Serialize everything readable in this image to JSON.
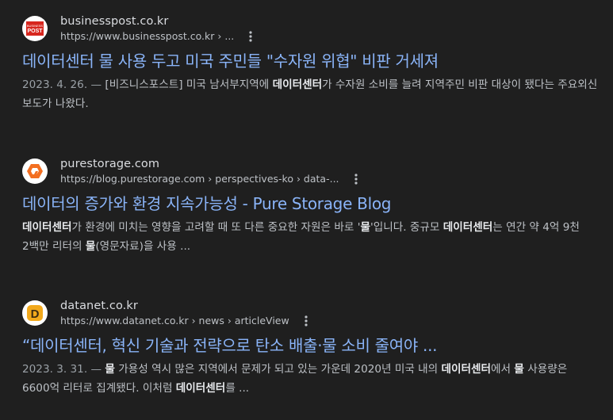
{
  "results": [
    {
      "site_name": "businesspost.co.kr",
      "url": "https://www.businesspost.co.kr › ...",
      "favicon": {
        "name": "businesspost-logo",
        "text": "POST",
        "color": "#d7261e"
      },
      "title": "데이터센터 물 사용 두고 미국 주민들 \"수자원 위협\" 비판 거세져",
      "snippet_parts": [
        {
          "text": "2023. 4. 26. — ",
          "style": "date"
        },
        {
          "text": "[비즈니스포스트] 미국 남서부지역에 ",
          "style": "normal"
        },
        {
          "text": "데이터센터",
          "style": "bold"
        },
        {
          "text": "가 수자원 소비를 늘려 지역주민 비판 대상이 됐다는 주요외신 보도가 나왔다.",
          "style": "normal"
        }
      ]
    },
    {
      "site_name": "purestorage.com",
      "url": "https://blog.purestorage.com › perspectives-ko › data-...",
      "favicon": {
        "name": "purestorage-logo",
        "color": "#f36f21"
      },
      "title": "데이터의 증가와 환경 지속가능성 - Pure Storage Blog",
      "snippet_parts": [
        {
          "text": "데이터센터",
          "style": "bold"
        },
        {
          "text": "가 환경에 미치는 영향을 고려할 때 또 다른 중요한 자원은 바로 '",
          "style": "normal"
        },
        {
          "text": "물",
          "style": "bold"
        },
        {
          "text": "'입니다. 중규모 ",
          "style": "normal"
        },
        {
          "text": "데이터센터",
          "style": "bold"
        },
        {
          "text": "는 연간 약 4억 9천 2백만 리터의 ",
          "style": "normal"
        },
        {
          "text": "물",
          "style": "bold"
        },
        {
          "text": "(영문자료)을 사용 ...",
          "style": "normal"
        }
      ]
    },
    {
      "site_name": "datanet.co.kr",
      "url": "https://www.datanet.co.kr › news › articleView",
      "favicon": {
        "name": "datanet-logo",
        "text": "D",
        "color": "#f2a91c"
      },
      "title": "“데이터센터, 혁신 기술과 전략으로 탄소 배출·물 소비 줄여야 ...",
      "snippet_parts": [
        {
          "text": "2023. 3. 31. — ",
          "style": "date"
        },
        {
          "text": "물",
          "style": "bold"
        },
        {
          "text": " 가용성 역시 많은 지역에서 문제가 되고 있는 가운데 2020년 미국 내의 ",
          "style": "normal"
        },
        {
          "text": "데이터센터",
          "style": "bold"
        },
        {
          "text": "에서 ",
          "style": "normal"
        },
        {
          "text": "물",
          "style": "bold"
        },
        {
          "text": " 사용량은 6600억 리터로 집계됐다. 이처럼 ",
          "style": "normal"
        },
        {
          "text": "데이터센터",
          "style": "bold"
        },
        {
          "text": "를 ...",
          "style": "normal"
        }
      ]
    }
  ]
}
